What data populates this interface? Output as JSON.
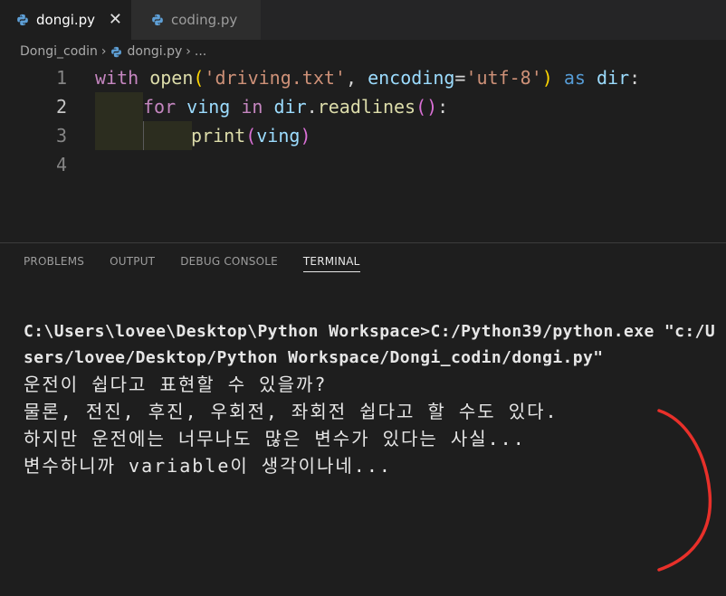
{
  "tabs": [
    {
      "label": "dongi.py",
      "active": true
    },
    {
      "label": "coding.py",
      "active": false
    }
  ],
  "tab_close_glyph": "✕",
  "breadcrumb": {
    "folder": "Dongi_codin",
    "sep1": "›",
    "file": "dongi.py",
    "sep2": "›",
    "more": "..."
  },
  "editor": {
    "line_numbers": [
      "1",
      "2",
      "3",
      "4"
    ],
    "line1": {
      "t1": "with",
      "t2": " ",
      "t3": "open",
      "t4": "(",
      "t5": "'driving.txt'",
      "t6": ", ",
      "t7": "encoding",
      "t8": "=",
      "t9": "'utf-8'",
      "t10": ")",
      "t11": " ",
      "t12": "as",
      "t13": " ",
      "t14": "dir",
      "t15": ":"
    },
    "line2": {
      "t1": "for",
      "t2": " ",
      "t3": "ving",
      "t4": " ",
      "t5": "in",
      "t6": " ",
      "t7": "dir",
      "t8": ".",
      "t9": "readlines",
      "t10": "()",
      "t11": ":"
    },
    "line3": {
      "t1": "print",
      "t2": "(",
      "t3": "ving",
      "t4": ")"
    }
  },
  "panel": {
    "tabs": [
      "PROBLEMS",
      "OUTPUT",
      "DEBUG CONSOLE",
      "TERMINAL"
    ],
    "active_tab": "TERMINAL"
  },
  "terminal": {
    "command": "C:\\Users\\lovee\\Desktop\\Python Workspace>C:/Python39/python.exe \"c:/Users/lovee/Desktop/Python Workspace/Dongi_codin/dongi.py\"",
    "output": [
      "운전이 쉽다고 표현할 수 있을까?",
      "",
      "물론, 전진, 후진, 우회전, 좌회전 쉽다고 할 수도 있다.",
      "",
      "하지만 운전에는 너무나도 많은 변수가 있다는 사실...",
      "",
      "변수하니까 variable이 생각이나네..."
    ]
  },
  "colors": {
    "annotation": "#e8302a",
    "keyword": "#569cd6",
    "control": "#c586c0",
    "function": "#dcdcaa",
    "string": "#ce9178",
    "variable": "#9cdcfe"
  },
  "icons": {
    "tab_file_icon": "python-file-icon",
    "annotation": "red-bracket-annotation"
  }
}
